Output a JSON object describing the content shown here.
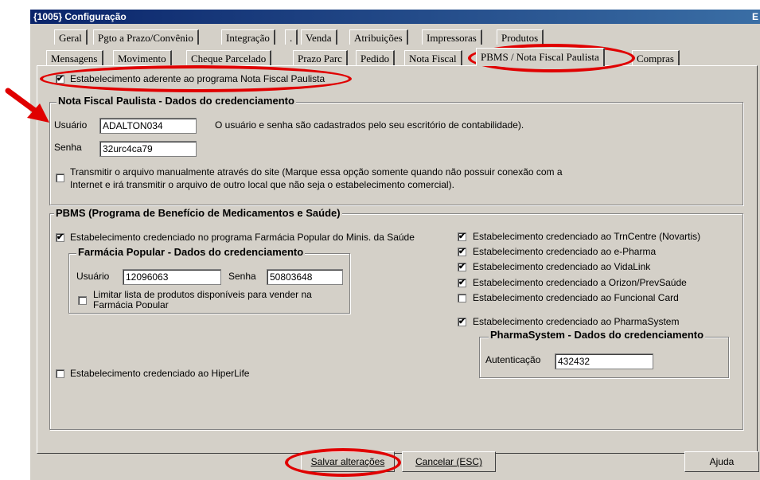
{
  "window": {
    "title": "{1005} Configuração",
    "title_extra": "E"
  },
  "tabs_row1": [
    "Geral",
    "Pgto a Prazo/Convênio",
    "Integração",
    ".",
    "Venda",
    "Atribuições",
    "Impressoras",
    "Produtos"
  ],
  "tabs_row2": [
    "Mensagens",
    "Movimento",
    "Cheque Parcelado",
    "Prazo Parc",
    "Pedido",
    "Nota Fiscal",
    "PBMS / Nota Fiscal Paulista",
    "Compras"
  ],
  "nfp": {
    "adherent_label": "Estabelecimento aderente ao programa Nota Fiscal Paulista",
    "adherent_checked": "✔",
    "group_title": "Nota Fiscal Paulista - Dados do credenciamento",
    "user_label": "Usuário",
    "user_value": "ADALTON034",
    "info_text": "O usuário e senha são cadastrados pelo seu escritório de contabilidade).",
    "password_label": "Senha",
    "password_value": "32urc4ca79",
    "manual_line1": "Transmitir o arquivo manualmente através do site (Marque essa opção somente quando não possuir conexão com a",
    "manual_line2": "Internet e irá transmitir o arquivo de outro local que não seja o estabelecimento comercial)."
  },
  "pbms": {
    "group_title": "PBMS (Programa de Benefício de Medicamentos e Saúde)",
    "farmacia_label": "Estabelecimento credenciado no programa Farmácia Popular do Minis. da Saúde",
    "farmacia_group_title": "Farmácia Popular - Dados do credenciamento",
    "fp_user_label": "Usuário",
    "fp_user_value": "12096063",
    "fp_pass_label": "Senha",
    "fp_pass_value": "50803648",
    "limit_line1": "Limitar lista de produtos disponíveis para vender na",
    "limit_line2": "Farmácia Popular",
    "hiperlife_label": "Estabelecimento credenciado ao HiperLife",
    "right_items": [
      {
        "label": "Estabelecimento credenciado ao TrnCentre (Novartis)",
        "mark": "✔"
      },
      {
        "label": "Estabelecimento credenciado ao e-Pharma",
        "mark": "✔"
      },
      {
        "label": "Estabelecimento credenciado ao VidaLink",
        "mark": "✔"
      },
      {
        "label": "Estabelecimento credenciado a Orizon/PrevSaúde",
        "mark": "✔"
      },
      {
        "label": "Estabelecimento credenciado ao Funcional Card",
        "mark": ""
      }
    ],
    "pharmasystem_label": "Estabelecimento credenciado ao PharmaSystem",
    "pharmasystem_mark": "✔",
    "pharmasystem_group_title": "PharmaSystem - Dados do credenciamento",
    "auth_label": "Autenticação",
    "auth_value": "432432",
    "fp_mark": "✔"
  },
  "buttons": {
    "save": "Salvar alterações",
    "cancel": "Cancelar (ESC)",
    "help": "Ajuda"
  },
  "colors": {
    "window_bg": "#d4d0c8",
    "title_bg": "#0a246a",
    "annotation": "#e00000"
  }
}
